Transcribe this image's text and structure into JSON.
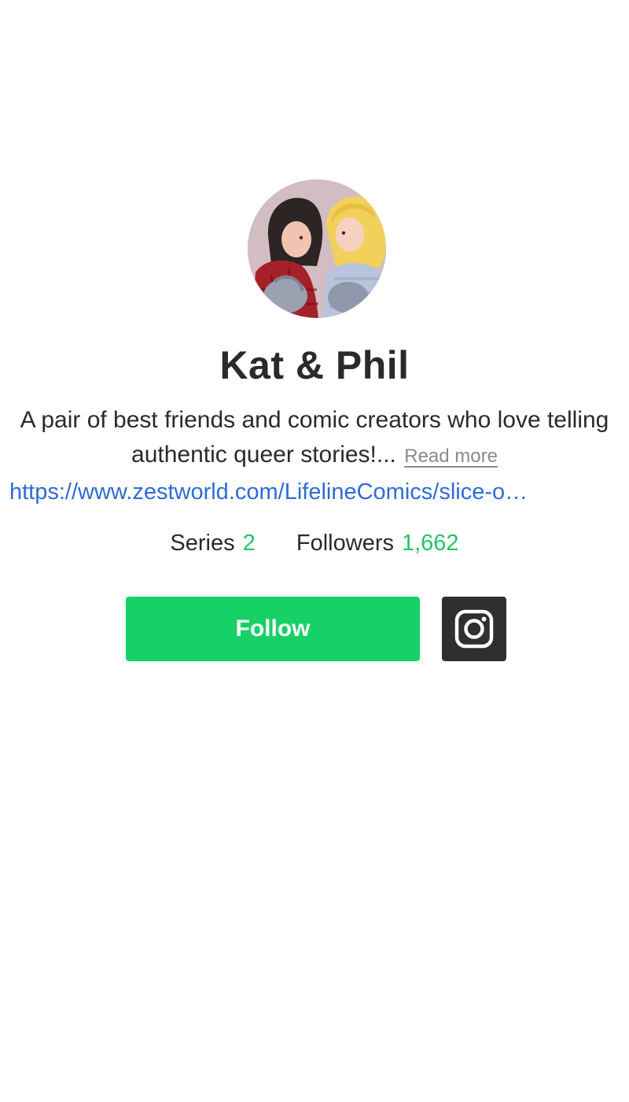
{
  "profile": {
    "avatar_alt": "Kat & Phil avatar",
    "name": "Kat & Phil",
    "bio": "A pair of best friends and comic creators who love telling authentic queer stories!...",
    "read_more_label": "Read more",
    "link_text": "https://www.zestworld.com/LifelineComics/slice-o…"
  },
  "stats": {
    "series_label": "Series",
    "series_value": "2",
    "followers_label": "Followers",
    "followers_value": "1,662"
  },
  "actions": {
    "follow_label": "Follow",
    "instagram_icon": "instagram-icon"
  },
  "colors": {
    "accent_green": "#16d166",
    "count_green": "#27c26a",
    "link_blue": "#2e6bd8",
    "instagram_bg": "#2f2f2f"
  }
}
